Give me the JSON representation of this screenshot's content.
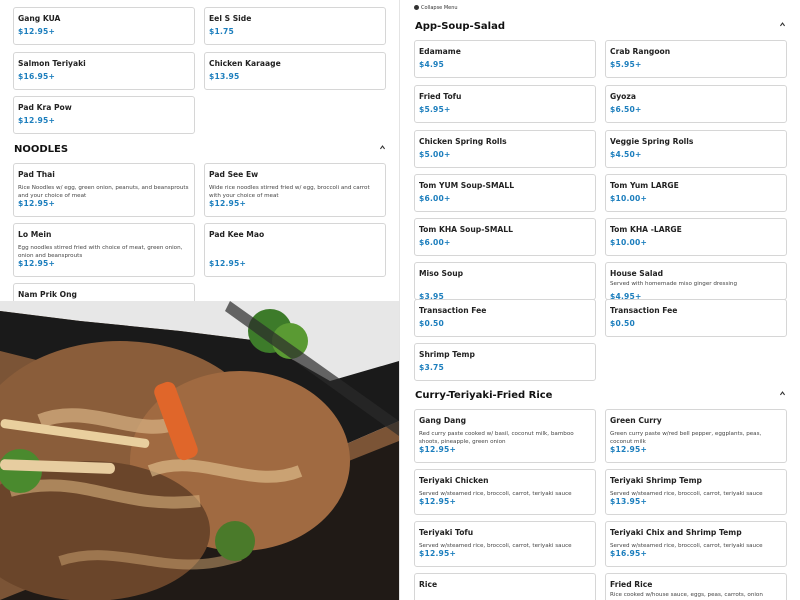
{
  "collapse_menu": "Collapse Menu",
  "left": {
    "top_items": [
      {
        "name": "Gang KUA",
        "price": "$12.95+"
      },
      {
        "name": "Eel S Side",
        "price": "$1.75"
      },
      {
        "name": "Salmon Teriyaki",
        "price": "$16.95+"
      },
      {
        "name": "Chicken Karaage",
        "price": "$13.95"
      },
      {
        "name": "Pad Kra Pow",
        "price": "$12.95+"
      }
    ],
    "noodles": {
      "title": "NOODLES",
      "items": [
        {
          "name": "Pad Thai",
          "desc": "Rice Noodles w/ egg, green onion, peanuts, and beansprouts and your choice of meat",
          "price": "$12.95+"
        },
        {
          "name": "Pad See Ew",
          "desc": "Wide rice noodles stirred fried w/ egg, broccoli and carrot with your choice of meat",
          "price": "$12.95+"
        },
        {
          "name": "Lo Mein",
          "desc": "Egg noodles stirred fried with choice of meat, green onion, onion and beansprouts",
          "price": "$12.95+"
        },
        {
          "name": "Pad Kee Mao",
          "desc": "",
          "price": "$12.95+"
        },
        {
          "name": "Nam Prik Ong",
          "desc": "",
          "price": ""
        }
      ]
    }
  },
  "right": {
    "app_soup_salad": {
      "title": "App-Soup-Salad",
      "items": [
        {
          "name": "Edamame",
          "desc": "",
          "price": "$4.95"
        },
        {
          "name": "Crab Rangoon",
          "desc": "",
          "price": "$5.95+"
        },
        {
          "name": "Fried Tofu",
          "desc": "",
          "price": "$5.95+"
        },
        {
          "name": "Gyoza",
          "desc": "",
          "price": "$6.50+"
        },
        {
          "name": "Chicken Spring Rolls",
          "desc": "",
          "price": "$5.00+"
        },
        {
          "name": "Veggie Spring Rolls",
          "desc": "",
          "price": "$4.50+"
        },
        {
          "name": "Tom YUM Soup-SMALL",
          "desc": "",
          "price": "$6.00+"
        },
        {
          "name": "Tom Yum LARGE",
          "desc": "",
          "price": "$10.00+"
        },
        {
          "name": "Tom KHA Soup-SMALL",
          "desc": "",
          "price": "$6.00+"
        },
        {
          "name": "Tom KHA -LARGE",
          "desc": "",
          "price": "$10.00+"
        },
        {
          "name": "Miso Soup",
          "desc": "",
          "price": "$3.95"
        },
        {
          "name": "House Salad",
          "desc": "Served with homemade miso ginger dressing",
          "price": "$4.95+"
        },
        {
          "name": "Transaction Fee",
          "desc": "",
          "price": "$0.50"
        },
        {
          "name": "Transaction Fee",
          "desc": "",
          "price": "$0.50"
        },
        {
          "name": "Shrimp Temp",
          "desc": "",
          "price": "$3.75"
        }
      ]
    },
    "curry": {
      "title": "Curry-Teriyaki-Fried Rice",
      "items": [
        {
          "name": "Gang Dang",
          "desc": "Red curry paste cooked w/ basil, coconut milk, bamboo shoots, pineapple, green onion",
          "price": "$12.95+"
        },
        {
          "name": "Green Curry",
          "desc": "Green curry paste w/red bell pepper, eggplants, peas, coconut milk",
          "price": "$12.95+"
        },
        {
          "name": "Teriyaki Chicken",
          "desc": "Served w/steamed rice, broccoli, carrot, teriyaki sauce",
          "price": "$12.95+"
        },
        {
          "name": "Teriyaki Shrimp Temp",
          "desc": "Served w/steamed rice, broccoli, carrot, teriyaki sauce",
          "price": "$13.95+"
        },
        {
          "name": "Teriyaki Tofu",
          "desc": "Served w/steamed rice, broccoli, carrot, teriyaki sauce",
          "price": "$12.95+"
        },
        {
          "name": "Teriyaki Chix and Shrimp Temp",
          "desc": "Served w/steamed rice, broccoli, carrot, teriyaki sauce",
          "price": "$16.95+"
        },
        {
          "name": "Rice",
          "desc": "",
          "price": ""
        },
        {
          "name": "Fried Rice",
          "desc": "Rice cooked w/house sauce, eggs, peas, carrots, onion",
          "price": ""
        }
      ]
    }
  },
  "colors": {
    "price": "#1c7ebd",
    "border": "#d6d6d6"
  },
  "icons": {
    "collapse": "collapse-icon",
    "chevron": "chevron-up-icon"
  }
}
